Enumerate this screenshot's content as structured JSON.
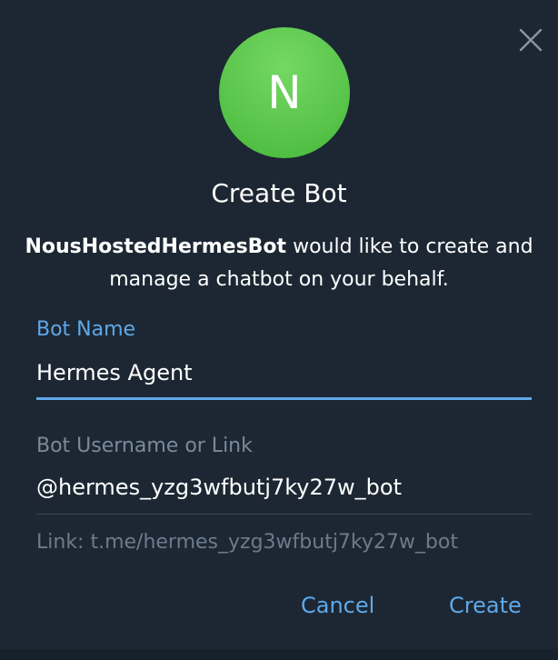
{
  "dialog": {
    "avatar_letter": "N",
    "avatar_color": "#5cc64d",
    "title": "Create Bot",
    "requester": "NousHostedHermesBot",
    "request_text": " would like to create and manage a chatbot on your behalf.",
    "close_icon": "close-icon"
  },
  "form": {
    "name_label": "Bot Name",
    "name_value": "Hermes Agent",
    "username_label": "Bot Username or Link",
    "username_value": "@hermes_yzg3wfbutj7ky27w_bot",
    "link_hint": "Link: t.me/hermes_yzg3wfbutj7ky27w_bot"
  },
  "actions": {
    "cancel_label": "Cancel",
    "create_label": "Create"
  },
  "colors": {
    "background": "#1c2733",
    "accent": "#5fa8e8",
    "muted": "#7a8a9a"
  }
}
